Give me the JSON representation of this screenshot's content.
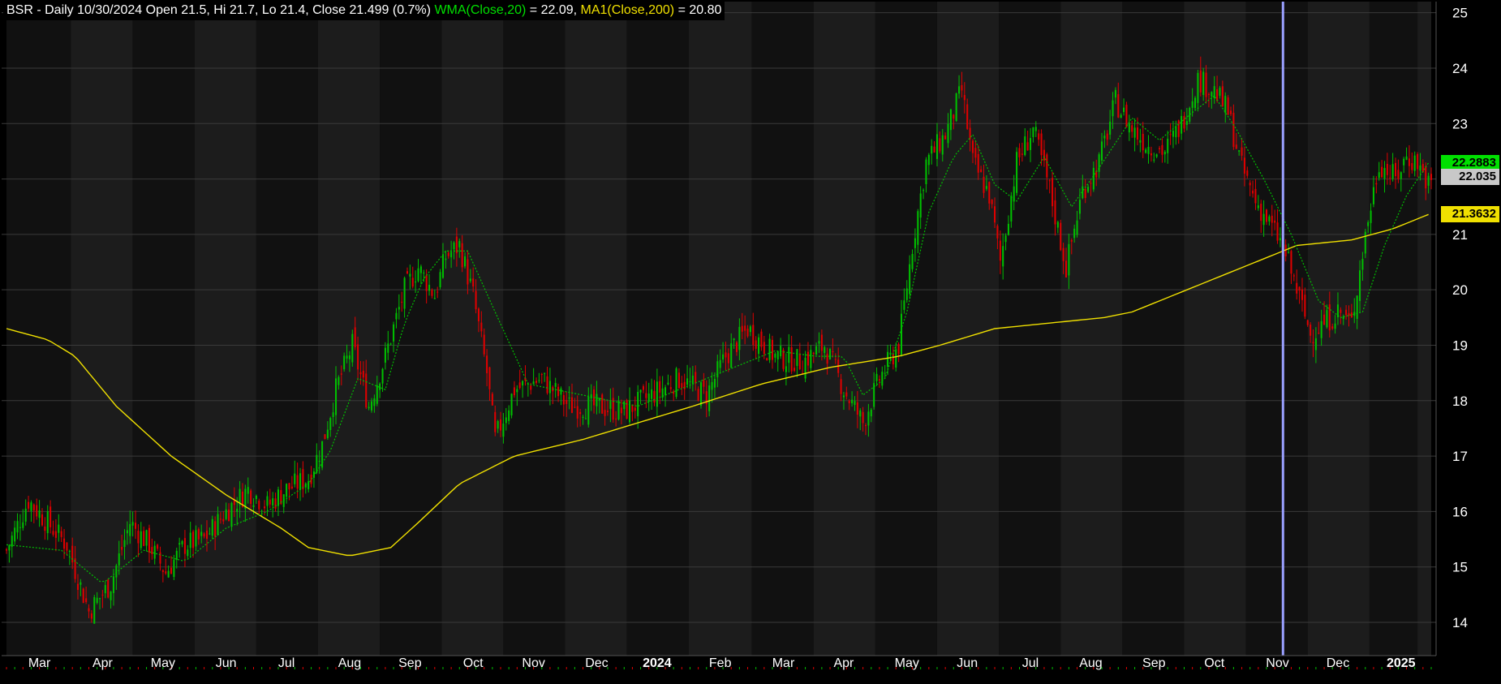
{
  "header": {
    "ticker_info": "BSR - Daily 10/30/2024 Open 21.5, Hi 21.7, Lo 21.4, Close 21.499 (0.7%)",
    "wma_label": "WMA(Close,20)",
    "wma_value": "= 22.09,",
    "ma_label": "MA1(Close,200)",
    "ma_value": "= 20.80"
  },
  "price_tags": {
    "last_wma": "22.2883",
    "last_close": "22.035",
    "last_ma": "21.3632"
  },
  "colors": {
    "background": "#000000",
    "panel_band_a": "#1c1c1c",
    "panel_band_b": "#111111",
    "up_candle": "#00c000",
    "down_candle": "#e00000",
    "wma_line": "#00c000",
    "ma_line": "#f0e000",
    "cursor_line": "#9aa0ff",
    "axis_text": "#ffffff"
  },
  "chart_data": {
    "type": "candlestick",
    "ylim": [
      13.4,
      25.2
    ],
    "yticks": [
      "14",
      "15",
      "16",
      "17",
      "18",
      "19",
      "20",
      "21",
      "22",
      "23",
      "24",
      "25"
    ],
    "xticks": [
      "Mar",
      "Apr",
      "May",
      "Jun",
      "Jul",
      "Aug",
      "Sep",
      "Oct",
      "Nov",
      "Dec",
      "2024",
      "Feb",
      "Mar",
      "Apr",
      "May",
      "Jun",
      "Jul",
      "Aug",
      "Sep",
      "Oct",
      "Nov",
      "Dec",
      "2025"
    ],
    "close_path": [
      [
        0,
        15.3
      ],
      [
        8,
        16.2
      ],
      [
        15,
        15.8
      ],
      [
        22,
        15.4
      ],
      [
        30,
        14.2
      ],
      [
        38,
        14.7
      ],
      [
        45,
        15.8
      ],
      [
        52,
        15.4
      ],
      [
        58,
        14.9
      ],
      [
        65,
        15.4
      ],
      [
        72,
        15.5
      ],
      [
        80,
        16.0
      ],
      [
        88,
        16.4
      ],
      [
        95,
        16.1
      ],
      [
        102,
        16.4
      ],
      [
        110,
        16.6
      ],
      [
        115,
        17.2
      ],
      [
        120,
        18.2
      ],
      [
        126,
        19.0
      ],
      [
        132,
        17.9
      ],
      [
        138,
        18.8
      ],
      [
        145,
        20.0
      ],
      [
        150,
        20.4
      ],
      [
        156,
        19.9
      ],
      [
        160,
        20.6
      ],
      [
        165,
        20.8
      ],
      [
        170,
        19.9
      ],
      [
        175,
        18.5
      ],
      [
        178,
        17.3
      ],
      [
        185,
        18.2
      ],
      [
        195,
        18.4
      ],
      [
        205,
        17.9
      ],
      [
        215,
        17.9
      ],
      [
        225,
        17.8
      ],
      [
        235,
        18.1
      ],
      [
        245,
        18.4
      ],
      [
        255,
        18.1
      ],
      [
        262,
        18.8
      ],
      [
        270,
        19.3
      ],
      [
        280,
        18.8
      ],
      [
        290,
        18.7
      ],
      [
        298,
        19.0
      ],
      [
        305,
        18.2
      ],
      [
        312,
        17.6
      ],
      [
        318,
        18.4
      ],
      [
        325,
        19.0
      ],
      [
        330,
        20.8
      ],
      [
        335,
        22.3
      ],
      [
        342,
        22.8
      ],
      [
        348,
        23.6
      ],
      [
        352,
        22.3
      ],
      [
        358,
        21.7
      ],
      [
        362,
        20.5
      ],
      [
        368,
        22.3
      ],
      [
        374,
        22.9
      ],
      [
        380,
        21.8
      ],
      [
        386,
        20.4
      ],
      [
        392,
        21.8
      ],
      [
        398,
        22.3
      ],
      [
        404,
        23.4
      ],
      [
        410,
        22.9
      ],
      [
        416,
        22.6
      ],
      [
        422,
        22.5
      ],
      [
        428,
        23.0
      ],
      [
        434,
        23.8
      ],
      [
        440,
        23.6
      ],
      [
        445,
        23.2
      ],
      [
        450,
        22.2
      ],
      [
        455,
        21.6
      ],
      [
        460,
        21.2
      ],
      [
        465,
        20.8
      ],
      [
        470,
        20.0
      ],
      [
        475,
        19.2
      ],
      [
        480,
        19.4
      ],
      [
        485,
        19.6
      ],
      [
        490,
        19.4
      ],
      [
        495,
        21.0
      ],
      [
        500,
        22.3
      ],
      [
        506,
        22.0
      ],
      [
        510,
        22.4
      ],
      [
        514,
        22.3
      ],
      [
        518,
        21.9
      ]
    ],
    "wma_path": [
      [
        0,
        15.4
      ],
      [
        20,
        15.3
      ],
      [
        35,
        14.7
      ],
      [
        50,
        15.3
      ],
      [
        65,
        15.1
      ],
      [
        80,
        15.7
      ],
      [
        95,
        16.0
      ],
      [
        110,
        16.5
      ],
      [
        118,
        17.1
      ],
      [
        128,
        18.4
      ],
      [
        138,
        18.2
      ],
      [
        145,
        19.4
      ],
      [
        152,
        20.2
      ],
      [
        160,
        20.7
      ],
      [
        168,
        20.7
      ],
      [
        178,
        19.6
      ],
      [
        190,
        18.3
      ],
      [
        210,
        18.1
      ],
      [
        230,
        17.9
      ],
      [
        250,
        18.3
      ],
      [
        265,
        18.6
      ],
      [
        280,
        18.9
      ],
      [
        295,
        18.8
      ],
      [
        305,
        18.8
      ],
      [
        312,
        18.1
      ],
      [
        320,
        18.4
      ],
      [
        328,
        19.6
      ],
      [
        336,
        21.4
      ],
      [
        345,
        22.4
      ],
      [
        352,
        22.8
      ],
      [
        360,
        21.9
      ],
      [
        368,
        21.6
      ],
      [
        378,
        22.4
      ],
      [
        388,
        21.5
      ],
      [
        398,
        22.2
      ],
      [
        410,
        23.1
      ],
      [
        420,
        22.7
      ],
      [
        432,
        23.2
      ],
      [
        440,
        23.5
      ],
      [
        448,
        22.9
      ],
      [
        458,
        22.0
      ],
      [
        468,
        21.0
      ],
      [
        478,
        19.8
      ],
      [
        486,
        19.5
      ],
      [
        494,
        19.6
      ],
      [
        502,
        20.8
      ],
      [
        510,
        21.7
      ],
      [
        518,
        22.29
      ]
    ],
    "ma_path": [
      [
        0,
        19.3
      ],
      [
        15,
        19.1
      ],
      [
        25,
        18.8
      ],
      [
        40,
        17.9
      ],
      [
        60,
        17.0
      ],
      [
        80,
        16.3
      ],
      [
        100,
        15.7
      ],
      [
        110,
        15.35
      ],
      [
        125,
        15.2
      ],
      [
        140,
        15.35
      ],
      [
        150,
        15.8
      ],
      [
        165,
        16.5
      ],
      [
        185,
        17.0
      ],
      [
        210,
        17.3
      ],
      [
        230,
        17.6
      ],
      [
        250,
        17.9
      ],
      [
        275,
        18.3
      ],
      [
        300,
        18.6
      ],
      [
        325,
        18.8
      ],
      [
        340,
        19.0
      ],
      [
        360,
        19.3
      ],
      [
        380,
        19.4
      ],
      [
        400,
        19.5
      ],
      [
        410,
        19.6
      ],
      [
        430,
        20.0
      ],
      [
        450,
        20.4
      ],
      [
        470,
        20.8
      ],
      [
        490,
        20.9
      ],
      [
        505,
        21.1
      ],
      [
        518,
        21.36
      ]
    ],
    "last_close": 22.035,
    "cursor_index": 465
  }
}
